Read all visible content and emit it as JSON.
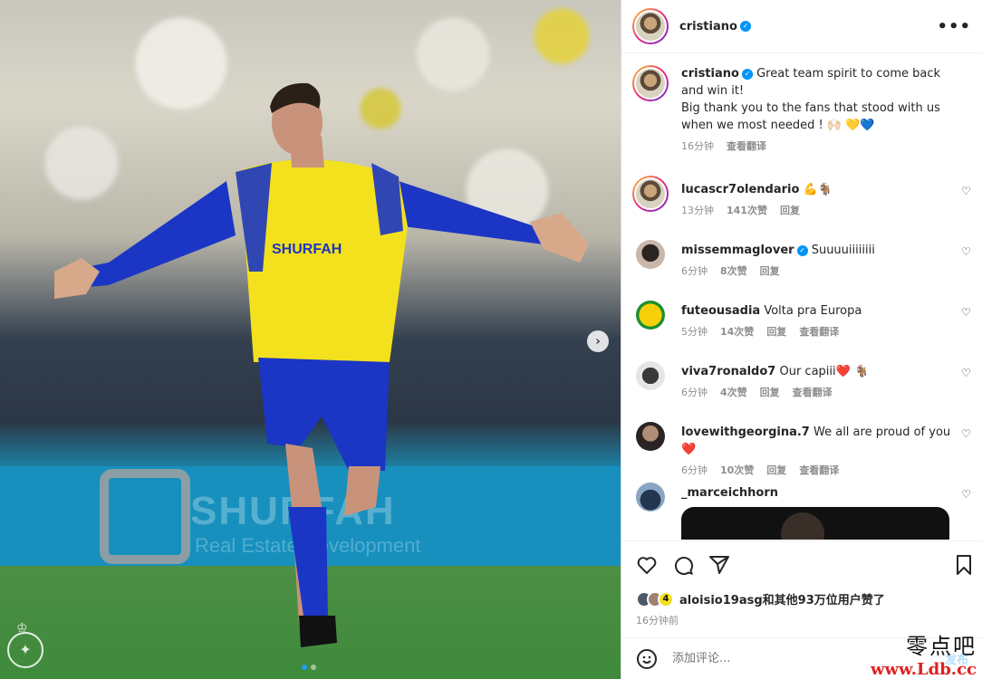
{
  "post": {
    "author": "cristiano",
    "more_icon": "more-horizontal-icon"
  },
  "caption": {
    "username": "cristiano",
    "text_line1": "Great team spirit to come back and win it!",
    "text_line2": "Big thank you to the fans that stood with us when we most needed ! 🙌🏻 💛💙",
    "time": "16分钟",
    "translate": "查看翻译"
  },
  "comments": [
    {
      "username": "lucascr7olendario",
      "text": "💪🐐",
      "time": "13分钟",
      "likes": "141次赞",
      "reply": "回复",
      "translate": ""
    },
    {
      "username": "missemmaglover",
      "verified": true,
      "text": "Suuuuiiiiiiii",
      "time": "6分钟",
      "likes": "8次赞",
      "reply": "回复",
      "translate": ""
    },
    {
      "username": "futeousadia",
      "text": "Volta pra Europa",
      "time": "5分钟",
      "likes": "14次赞",
      "reply": "回复",
      "translate": "查看翻译"
    },
    {
      "username": "viva7ronaldo7",
      "text": "Our capiii❤️ 🐐",
      "time": "6分钟",
      "likes": "4次赞",
      "reply": "回复",
      "translate": "查看翻译"
    },
    {
      "username": "lovewithgeorgina.7",
      "text": "We all are proud of you❤️",
      "time": "6分钟",
      "likes": "10次赞",
      "reply": "回复",
      "translate": "查看翻译"
    },
    {
      "username": "_marceichhorn",
      "text": "",
      "time": "",
      "likes": "",
      "reply": "",
      "translate": ""
    }
  ],
  "media": {
    "shirt_text": "SHURFAH",
    "board_text": "SHURFAH",
    "board_sub": "Real Estate Development",
    "badge_text": "AL NASSR",
    "carousel_dots": 2,
    "active_dot": 0
  },
  "likes": {
    "count_badge": "4",
    "text": "aloisio19asg和其他93万位用户赞了",
    "ago": "16分钟前"
  },
  "add_comment": {
    "placeholder": "添加评论...",
    "post_label": "发布"
  },
  "watermark": {
    "cn": "零点吧",
    "url": "www.Ldb.cc"
  },
  "colors": {
    "verified": "#0095f6",
    "jersey_yellow": "#f3e11d",
    "jersey_blue": "#1b36c4"
  }
}
